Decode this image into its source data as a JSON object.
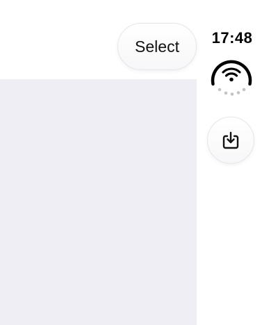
{
  "toolbar": {
    "select_label": "Select"
  },
  "status": {
    "time": "17:48",
    "wifi_icon": "wifi-icon",
    "download_icon": "download-tray-icon"
  },
  "colors": {
    "content_background": "#efeef4",
    "page_background": "#ffffff",
    "icon_color": "#111111",
    "progress_dots": "#c4c4c8"
  }
}
